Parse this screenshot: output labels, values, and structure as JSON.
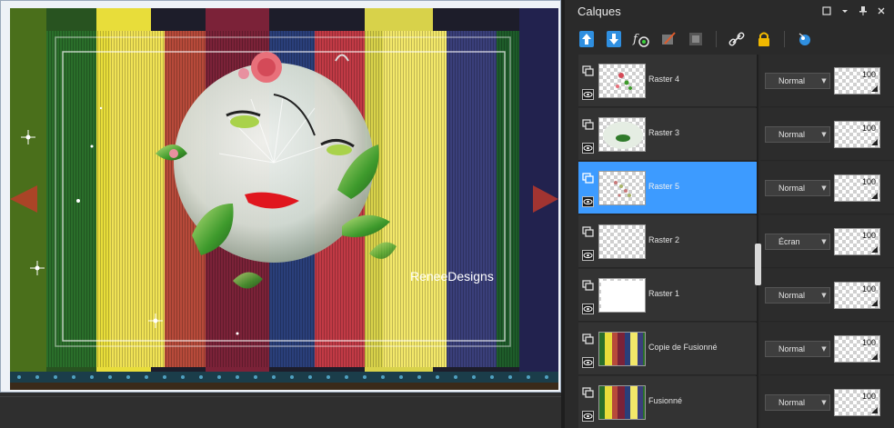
{
  "panel": {
    "title": "Calques"
  },
  "watermark": "ReneeDesigns",
  "layers": [
    {
      "name": "Raster 4",
      "blend": "Normal",
      "opacity": "100",
      "selected": false,
      "thumb": "raster4"
    },
    {
      "name": "Raster 3",
      "blend": "Normal",
      "opacity": "100",
      "selected": false,
      "thumb": "raster3"
    },
    {
      "name": "Raster 5",
      "blend": "Normal",
      "opacity": "100",
      "selected": true,
      "thumb": "raster5"
    },
    {
      "name": "Raster 2",
      "blend": "Écran",
      "opacity": "100",
      "selected": false,
      "thumb": "empty"
    },
    {
      "name": "Raster 1",
      "blend": "Normal",
      "opacity": "100",
      "selected": false,
      "thumb": "white"
    },
    {
      "name": "Copie de Fusionné",
      "blend": "Normal",
      "opacity": "100",
      "selected": false,
      "thumb": "stripes"
    },
    {
      "name": "Fusionné",
      "blend": "Normal",
      "opacity": "100",
      "selected": false,
      "thumb": "stripes"
    }
  ],
  "colors": {
    "selection": "#3d9bff",
    "panel_bg": "#2a2a2a"
  }
}
